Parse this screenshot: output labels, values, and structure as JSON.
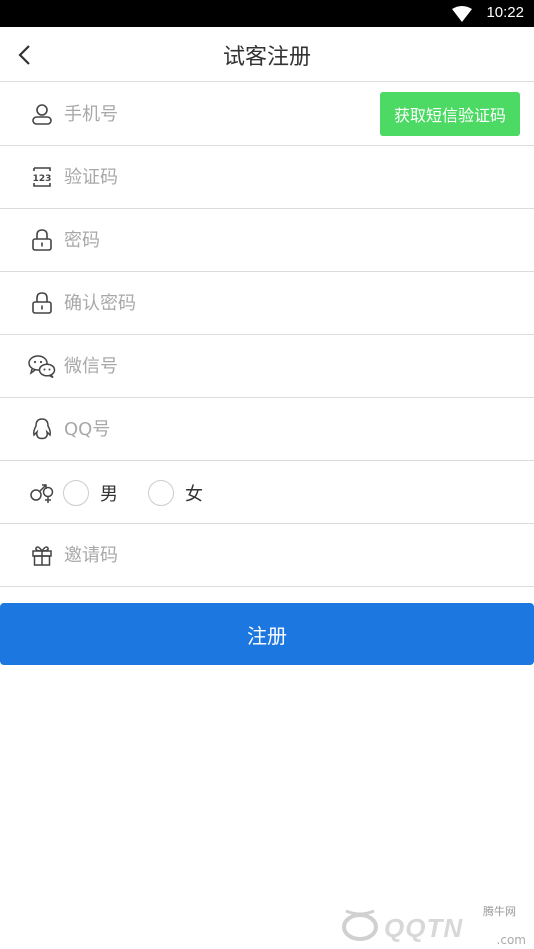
{
  "status_bar": {
    "time": "10:22"
  },
  "nav": {
    "title": "试客注册"
  },
  "form": {
    "phone_placeholder": "手机号",
    "sms_button": "获取短信验证码",
    "code_placeholder": "验证码",
    "password_placeholder": "密码",
    "confirm_password_placeholder": "确认密码",
    "wechat_placeholder": "微信号",
    "qq_placeholder": "QQ号",
    "gender_options": [
      "男",
      "女"
    ],
    "invite_placeholder": "邀请码"
  },
  "submit_label": "注册",
  "watermark": {
    "text": "QQTN",
    "small": "腾牛网",
    "sub": ".com"
  }
}
